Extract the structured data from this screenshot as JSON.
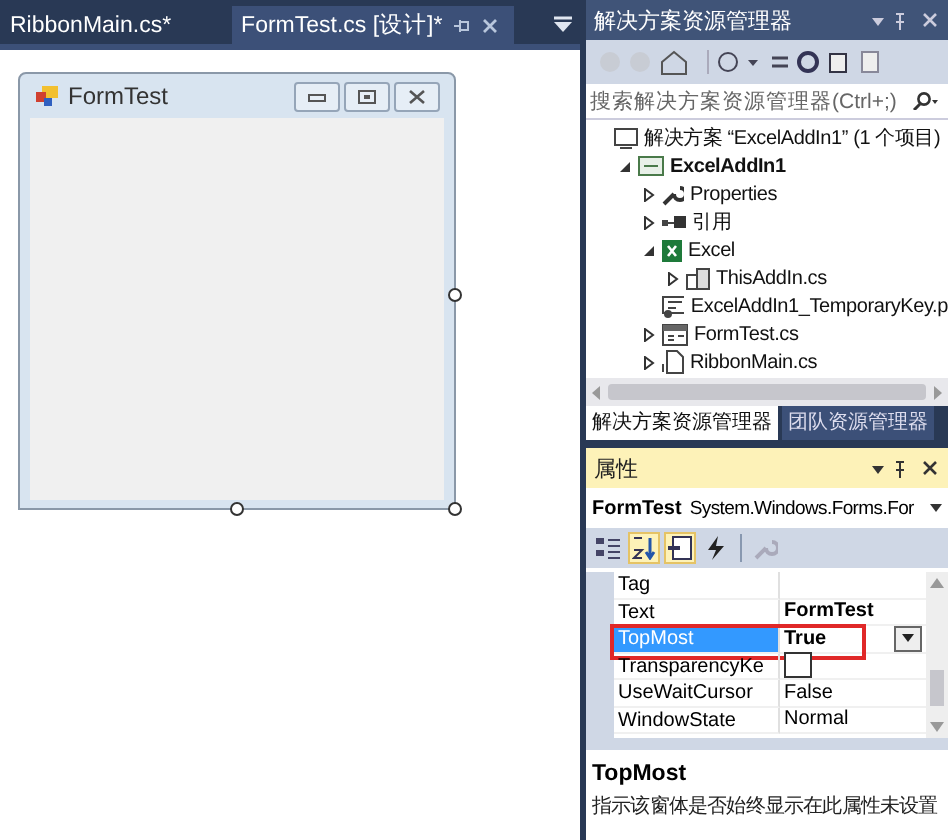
{
  "doc_tabs": [
    {
      "label": "RibbonMain.cs*",
      "selected": false
    },
    {
      "label": "FormTest.cs [设计]*",
      "selected": true
    }
  ],
  "form": {
    "title": "FormTest"
  },
  "solution_explorer": {
    "title": "解决方案资源管理器",
    "search": {
      "placeholder": "搜索解决方案资源管理器(Ctrl+;)"
    },
    "tree": [
      {
        "label": "解决方案 “ExcelAddIn1” (1 个项目)",
        "kind": "solution",
        "children": [
          {
            "label": "ExcelAddIn1",
            "kind": "project",
            "expanded": true,
            "children": [
              {
                "label": "Properties",
                "kind": "wrench",
                "expanded": false
              },
              {
                "label": "引用",
                "kind": "references",
                "expanded": false
              },
              {
                "label": "Excel",
                "kind": "excel",
                "expanded": true,
                "children": [
                  {
                    "label": "ThisAddIn.cs",
                    "kind": "addin",
                    "expanded": false
                  }
                ]
              },
              {
                "label": "ExcelAddIn1_TemporaryKey.p",
                "kind": "key"
              },
              {
                "label": "FormTest.cs",
                "kind": "form",
                "expanded": false
              },
              {
                "label": "RibbonMain.cs",
                "kind": "ribbon",
                "expanded": false
              }
            ]
          }
        ]
      }
    ]
  },
  "bottom_tabs": [
    {
      "label": "解决方案资源管理器",
      "selected": true
    },
    {
      "label": "团队资源管理器",
      "selected": false
    }
  ],
  "properties": {
    "title": "属性",
    "object_name": "FormTest",
    "object_type": "System.Windows.Forms.For",
    "toolbar": [
      {
        "kind": "categorized",
        "selected": false
      },
      {
        "kind": "alphabetical",
        "selected": true
      },
      {
        "kind": "properties",
        "selected": true
      },
      {
        "kind": "events",
        "selected": false
      },
      {
        "kind": "pages",
        "selected": false
      }
    ],
    "rows": [
      {
        "name": "Tag",
        "selected": false,
        "kind": "text"
      },
      {
        "name": "Text",
        "value": "FormTest",
        "selected": false,
        "modified": true,
        "kind": "text"
      },
      {
        "name": "TopMost",
        "value": "True",
        "selected": true,
        "modified": true,
        "annotated": true,
        "kind": "dropdown"
      },
      {
        "name": "TransparencyKe",
        "selected": false,
        "kind": "color",
        "color": "#ffffff"
      },
      {
        "name": "UseWaitCursor",
        "value": "False",
        "selected": false,
        "modified": false,
        "kind": "text"
      },
      {
        "name": "WindowState",
        "value": "Normal",
        "selected": false,
        "modified": false,
        "kind": "text"
      }
    ],
    "description": {
      "title": "TopMost",
      "text": "指示该窗体是否始终显示在此属性未设置"
    }
  }
}
